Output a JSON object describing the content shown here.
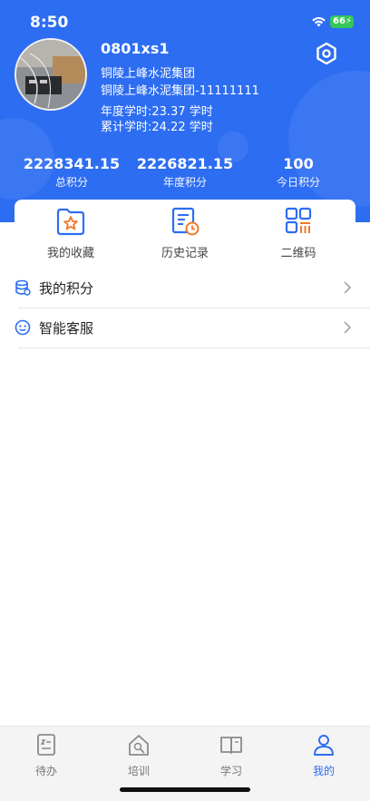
{
  "status_bar": {
    "time": "8:50",
    "battery": "66"
  },
  "profile": {
    "username": "0801xs1",
    "org_line1": "铜陵上峰水泥集团",
    "org_line2": "铜陵上峰水泥集团-11111111",
    "annual_hours": "年度学时:23.37 学时",
    "total_hours": "累计学时:24.22 学时"
  },
  "stats": [
    {
      "value": "2228341.15",
      "label": "总积分"
    },
    {
      "value": "2226821.15",
      "label": "年度积分"
    },
    {
      "value": "100",
      "label": "今日积分"
    }
  ],
  "quick_actions": [
    {
      "label": "我的收藏",
      "icon": "folder-star-icon"
    },
    {
      "label": "历史记录",
      "icon": "history-doc-icon"
    },
    {
      "label": "二维码",
      "icon": "qr-code-icon"
    }
  ],
  "menu": [
    {
      "label": "我的积分",
      "icon": "points-database-icon"
    },
    {
      "label": "智能客服",
      "icon": "smiley-service-icon"
    }
  ],
  "tabs": [
    {
      "label": "待办",
      "icon": "todo-icon",
      "active": false
    },
    {
      "label": "培训",
      "icon": "training-icon",
      "active": false
    },
    {
      "label": "学习",
      "icon": "book-icon",
      "active": false
    },
    {
      "label": "我的",
      "icon": "person-icon",
      "active": true
    }
  ],
  "colors": {
    "primary": "#2d6df2",
    "accent_orange": "#f07a2a",
    "battery": "#36c759"
  }
}
